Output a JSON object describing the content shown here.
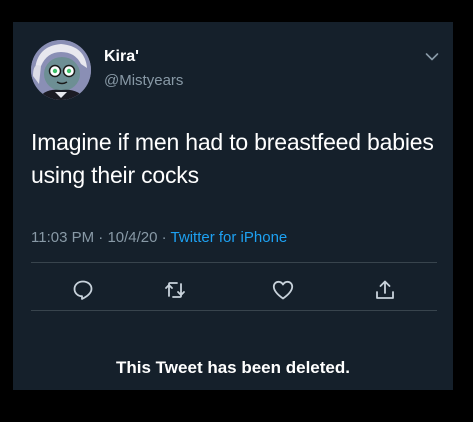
{
  "tweet": {
    "display_name": "Kira'",
    "handle": "@Mistyears",
    "text": "Imagine if men had to breastfeed babies using their cocks",
    "time": "11:03 PM",
    "date": "10/4/20",
    "separator": " · ",
    "source": "Twitter for iPhone"
  },
  "actions": {
    "reply_icon": "reply-icon",
    "retweet_icon": "retweet-icon",
    "like_icon": "heart-icon",
    "share_icon": "share-icon"
  },
  "notice": "This Tweet has been deleted.",
  "colors": {
    "background": "#15202b",
    "text": "#ffffff",
    "muted": "#8899a6",
    "link": "#1da1f2",
    "divider": "#38444d"
  }
}
